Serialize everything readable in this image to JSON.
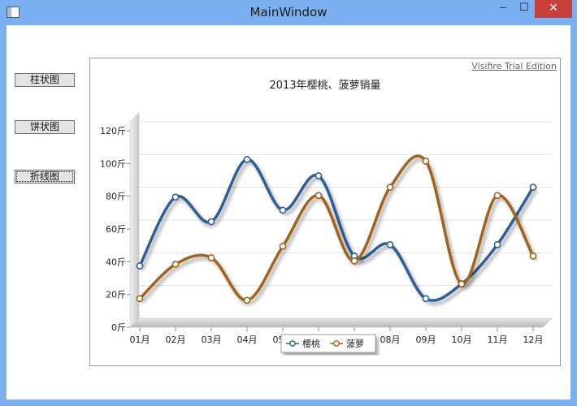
{
  "window": {
    "title": "MainWindow",
    "min_glyph": "‒",
    "max_glyph": "☐",
    "close_glyph": "✕"
  },
  "sidebar": {
    "buttons": [
      {
        "label": "柱状图"
      },
      {
        "label": "饼状图"
      },
      {
        "label": "折线图"
      }
    ]
  },
  "watermark": "Visifire Trial Edition",
  "chart_data": {
    "type": "line",
    "title": "2013年樱桃、菠萝销量",
    "categories": [
      "01月",
      "02月",
      "03月",
      "04月",
      "05月",
      "06月",
      "07月",
      "08月",
      "09月",
      "10月",
      "11月",
      "12月"
    ],
    "ylim": [
      0,
      120
    ],
    "yticks": [
      "0斤",
      "20斤",
      "40斤",
      "60斤",
      "80斤",
      "100斤",
      "120斤"
    ],
    "ytick_values": [
      0,
      20,
      40,
      60,
      80,
      100,
      120
    ],
    "grid": true,
    "legend_position": "bottom",
    "series": [
      {
        "name": "樱桃",
        "color": "#2f5f93",
        "values": [
          32,
          74,
          59,
          97,
          66,
          87,
          38,
          45,
          12,
          21,
          45,
          80
        ]
      },
      {
        "name": "菠萝",
        "color": "#a0641e",
        "values": [
          12,
          33,
          37,
          11,
          44,
          75,
          35,
          80,
          96,
          21,
          75,
          38
        ]
      }
    ]
  }
}
